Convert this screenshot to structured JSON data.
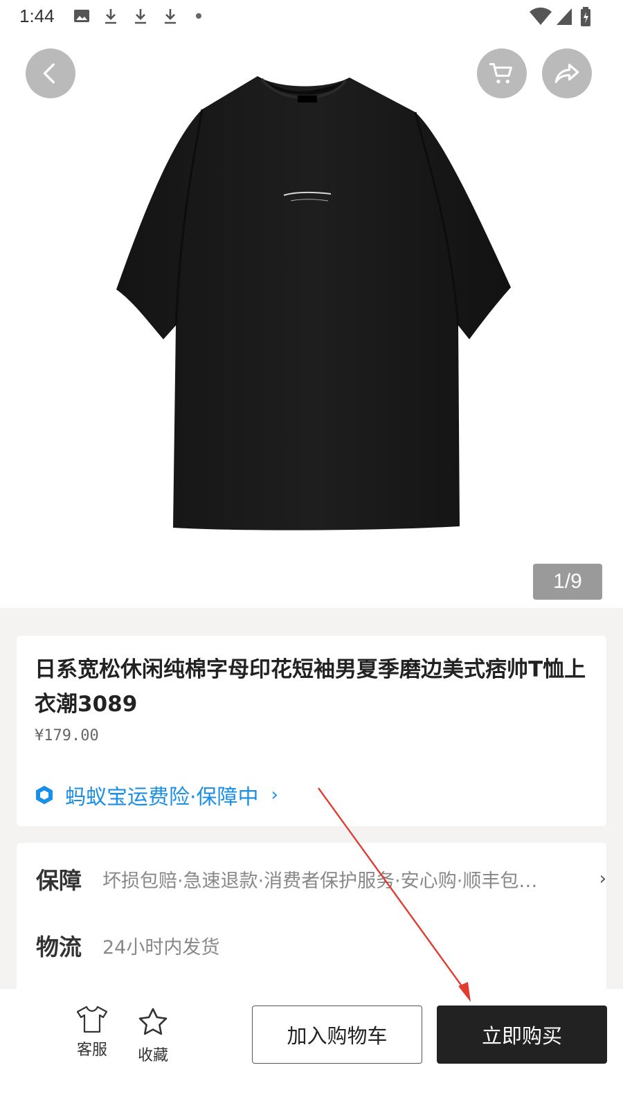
{
  "status_bar": {
    "time": "1:44"
  },
  "gallery": {
    "counter": "1/9"
  },
  "product": {
    "title": "日系宽松休闲纯棉字母印花短袖男夏季磨边美式痞帅T恤上衣潮3089",
    "price": "¥179.00",
    "insurance": "蚂蚁宝运费险·保障中"
  },
  "details": {
    "guarantee_label": "保障",
    "guarantee_value": "坏损包赔·急速退款·消费者保护服务·安心购·顺丰包…",
    "logistics_label": "物流",
    "logistics_value": "24小时内发货"
  },
  "bottom_bar": {
    "service_label": "客服",
    "favorite_label": "收藏",
    "add_cart_label": "加入购物车",
    "buy_now_label": "立即购买"
  },
  "colors": {
    "accent_blue": "#1a8fe8",
    "buy_button": "#222222",
    "annotation_arrow": "#e03c31"
  }
}
